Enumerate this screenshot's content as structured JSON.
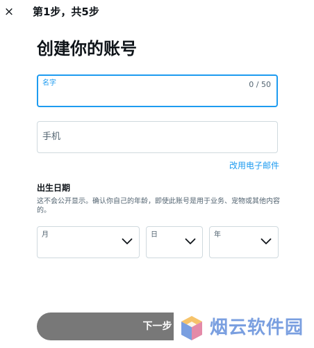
{
  "header": {
    "close_icon": "close-icon",
    "close_glyph": "×",
    "step_text": "第1步，共5步"
  },
  "main": {
    "title": "创建你的账号",
    "name_field": {
      "label": "名字",
      "counter": "0 / 50",
      "value": ""
    },
    "phone_field": {
      "placeholder": "手机"
    },
    "alt_link": "改用电子邮件",
    "dob": {
      "title": "出生日期",
      "description": "这不会公开显示。确认你自己的年龄，即使此账号是用于业务、宠物或其他内容的。",
      "month_label": "月",
      "day_label": "日",
      "year_label": "年"
    },
    "next_button": "下一步"
  },
  "watermark": {
    "text": "烟云软件园",
    "logo_icon": "cube-logo-icon"
  },
  "colors": {
    "accent": "#1d9bf0",
    "button_disabled": "#787878",
    "border": "#cfd9de",
    "text_secondary": "#536471",
    "watermark": "#7a9fe0"
  }
}
